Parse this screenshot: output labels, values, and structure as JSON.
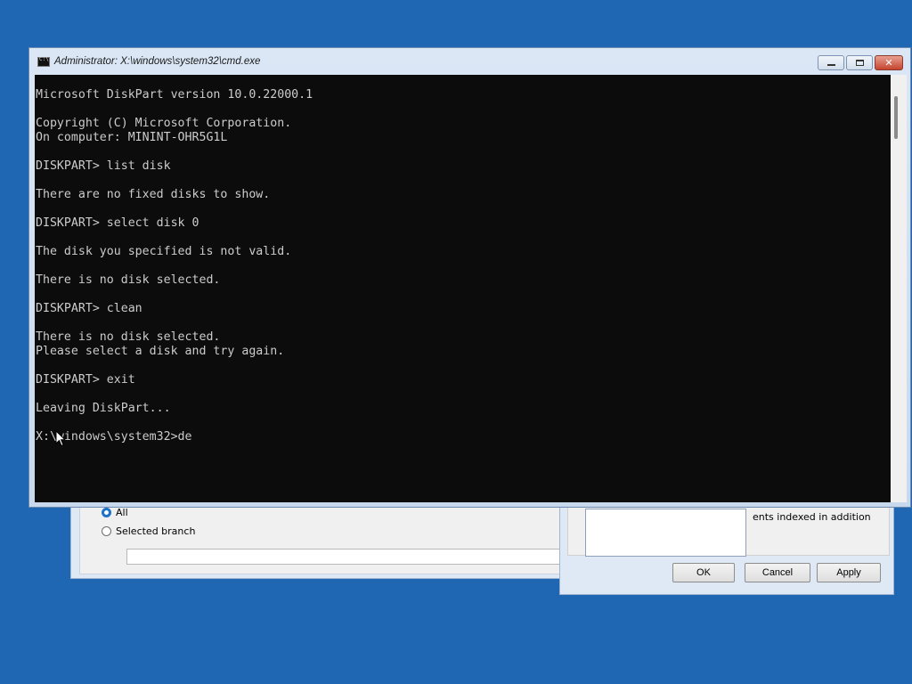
{
  "background_color": "#1f66b3",
  "dialog_left": {
    "radio_all_label": "All",
    "radio_selected_branch_label": "Selected branch",
    "branch_input_value": ""
  },
  "dialog_right": {
    "partial_text": "ents indexed in addition",
    "ok_label": "OK",
    "cancel_label": "Cancel",
    "apply_label": "Apply"
  },
  "cmd_window": {
    "title": "Administrator: X:\\windows\\system32\\cmd.exe",
    "icon": "cmd-icon",
    "controls": [
      "minimize-icon",
      "maximize-icon",
      "close-icon"
    ],
    "close_label": "✕",
    "console_text": "Microsoft DiskPart version 10.0.22000.1\n\nCopyright (C) Microsoft Corporation.\nOn computer: MININT-OHR5G1L\n\nDISKPART> list disk\n\nThere are no fixed disks to show.\n\nDISKPART> select disk 0\n\nThe disk you specified is not valid.\n\nThere is no disk selected.\n\nDISKPART> clean\n\nThere is no disk selected.\nPlease select a disk and try again.\n\nDISKPART> exit\n\nLeaving DiskPart...\n\nX:\\windows\\system32>de"
  }
}
